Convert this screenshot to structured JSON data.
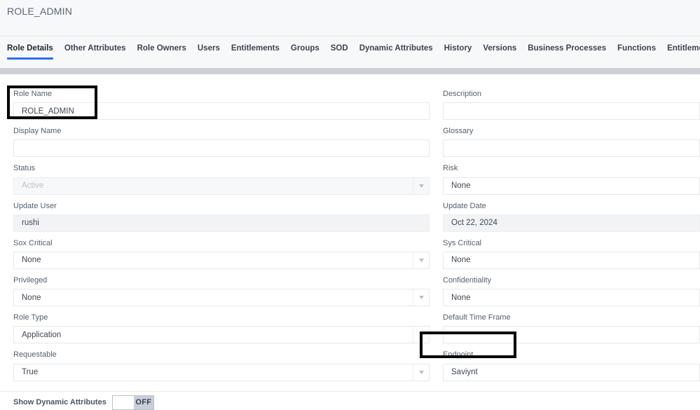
{
  "header": {
    "title": "ROLE_ADMIN"
  },
  "tabs": [
    {
      "label": "Role Details",
      "active": true
    },
    {
      "label": "Other Attributes",
      "active": false
    },
    {
      "label": "Role Owners",
      "active": false
    },
    {
      "label": "Users",
      "active": false
    },
    {
      "label": "Entitlements",
      "active": false
    },
    {
      "label": "Groups",
      "active": false
    },
    {
      "label": "SOD",
      "active": false
    },
    {
      "label": "Dynamic Attributes",
      "active": false
    },
    {
      "label": "History",
      "active": false
    },
    {
      "label": "Versions",
      "active": false
    },
    {
      "label": "Business Processes",
      "active": false
    },
    {
      "label": "Functions",
      "active": false
    },
    {
      "label": "Entitlement Hierarchy",
      "active": false
    }
  ],
  "form": {
    "left": [
      {
        "label": "Role Name",
        "value": "ROLE_ADMIN",
        "type": "text",
        "state": "normal"
      },
      {
        "label": "Display Name",
        "value": "",
        "type": "text",
        "state": "normal"
      },
      {
        "label": "Status",
        "value": "Active",
        "type": "select",
        "state": "disabled"
      },
      {
        "label": "Update User",
        "value": "rushi",
        "type": "text",
        "state": "readonly"
      },
      {
        "label": "Sox Critical",
        "value": "None",
        "type": "select",
        "state": "normal"
      },
      {
        "label": "Privileged",
        "value": "None",
        "type": "select",
        "state": "normal"
      },
      {
        "label": "Role Type",
        "value": "Application",
        "type": "select",
        "state": "normal"
      },
      {
        "label": "Requestable",
        "value": "True",
        "type": "select",
        "state": "normal"
      }
    ],
    "right": [
      {
        "label": "Description",
        "value": "",
        "type": "text",
        "state": "normal"
      },
      {
        "label": "Glossary",
        "value": "",
        "type": "text",
        "state": "normal"
      },
      {
        "label": "Risk",
        "value": "None",
        "type": "text",
        "state": "normal"
      },
      {
        "label": "Update Date",
        "value": "Oct 22, 2024",
        "type": "text",
        "state": "readonly"
      },
      {
        "label": "Sys Critical",
        "value": "None",
        "type": "text",
        "state": "normal"
      },
      {
        "label": "Confidentiality",
        "value": "None",
        "type": "text",
        "state": "normal"
      },
      {
        "label": "Default Time Frame",
        "value": "",
        "type": "text",
        "state": "normal"
      },
      {
        "label": "Endpoint",
        "value": "Saviynt",
        "type": "text",
        "state": "normal"
      }
    ]
  },
  "toggle": {
    "label": "Show Dynamic Attributes",
    "state": "OFF",
    "on": false
  },
  "annotations": [
    {
      "name": "role-name-highlight",
      "target": "Role Name"
    },
    {
      "name": "endpoint-highlight",
      "target": "Endpoint"
    }
  ],
  "colors": {
    "accent": "#2f6bf3",
    "title_text": "#5b6475",
    "label_text": "#54606e",
    "value_text": "#3f4754",
    "readonly_bg": "#f2f3f5",
    "chrome_bg": "#f7f8fa",
    "scrollband": "#cdd0d5",
    "highlight": "#000000"
  }
}
